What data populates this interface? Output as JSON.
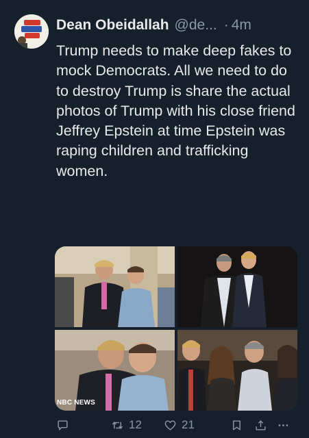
{
  "tweet": {
    "author": {
      "display_name": "Dean Obeidallah",
      "handle": "@de...",
      "avatar_icon": "avatar-image"
    },
    "separator": "·",
    "timestamp": "4m",
    "text": "Trump needs to make deep fakes to mock Democrats. All we need to do to destroy Trump is share the actual photos of Trump with his close friend Jeffrey Epstein at time Epstein was raping children and trafficking women.",
    "media": {
      "photo_count": 4,
      "watermark": "NBC NEWS"
    },
    "actions": {
      "reply_icon": "reply-icon",
      "retweet_icon": "retweet-icon",
      "retweet_count": "12",
      "like_icon": "heart-icon",
      "like_count": "21",
      "bookmark_icon": "bookmark-icon",
      "share_icon": "share-icon",
      "more_icon": "more-icon"
    }
  },
  "colors": {
    "background": "#15202b",
    "primary_text": "#e7e9ea",
    "secondary_text": "#8b98a5"
  }
}
